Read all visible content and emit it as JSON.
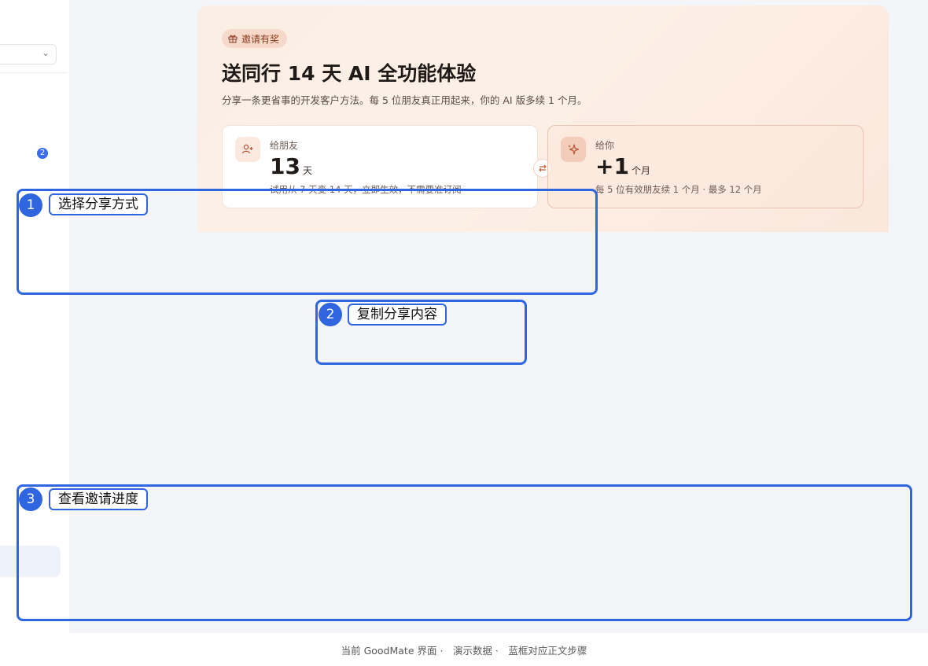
{
  "sidebar": {
    "badge_count": "2"
  },
  "hero": {
    "tag_label": "邀请有奖",
    "title": "送同行 14 天 AI 全功能体验",
    "subtitle": "分享一条更省事的开发客户方法。每 5 位朋友真正用起来，你的 AI 版多续 1 个月。",
    "friend_card": {
      "label": "给朋友",
      "value": "13",
      "unit": "天",
      "desc": "试用从 7 天变 14 天，立即生效，不需要准订阅"
    },
    "you_card": {
      "label": "给你",
      "value": "+1",
      "unit": "个月",
      "desc": "每 5 位有效朋友续 1 个月 · 最多 12 个月"
    }
  },
  "steps": [
    {
      "num": "1",
      "label": "选择分享方式"
    },
    {
      "num": "2",
      "label": "复制分享内容"
    },
    {
      "num": "3",
      "label": "查看邀请进度"
    }
  ],
  "footer": {
    "text": "当前 GoodMate 界面 ·　演示数据 ·　蓝框对应正文步骤"
  },
  "colors": {
    "accent": "#2f66e0",
    "hero_text": "#1f1a17",
    "tag_bg": "#f6d9c9"
  }
}
